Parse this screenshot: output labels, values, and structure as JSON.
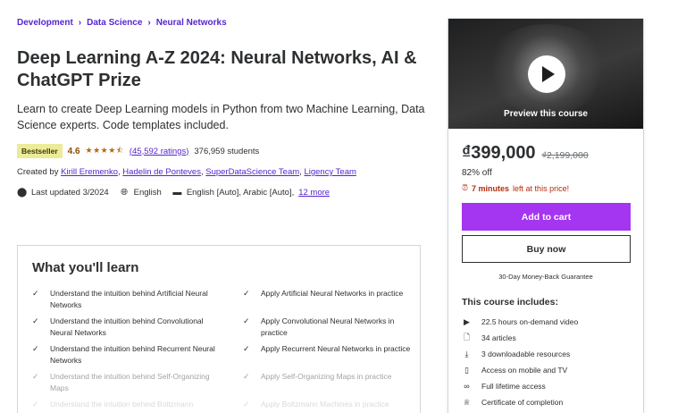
{
  "breadcrumb": [
    "Development",
    "Data Science",
    "Neural Networks"
  ],
  "course": {
    "title": "Deep Learning A-Z 2024: Neural Networks, AI & ChatGPT Prize",
    "subtitle": "Learn to create Deep Learning models in Python from two Machine Learning, Data Science experts. Code templates included.",
    "badge": "Bestseller",
    "rating": "4.6",
    "stars": "★★★★⯪",
    "ratings_count": "(45,592 ratings)",
    "students": "376,959 students",
    "created_by_label": "Created by",
    "authors": [
      "Kirill Eremenko",
      "Hadelin de Ponteves",
      "SuperDataScience Team",
      "Ligency Team"
    ],
    "last_updated": "Last updated 3/2024",
    "language": "English",
    "captions": "English [Auto], Arabic [Auto],",
    "captions_more": "12 more"
  },
  "learn": {
    "title": "What you'll learn",
    "left": [
      "Understand the intuition behind Artificial Neural Networks",
      "Understand the intuition behind Convolutional Neural Networks",
      "Understand the intuition behind Recurrent Neural Networks",
      "Understand the intuition behind Self-Organizing Maps",
      "Understand the intuition behind Boltzmann Machines"
    ],
    "right": [
      "Apply Artificial Neural Networks in practice",
      "Apply Convolutional Neural Networks in practice",
      "Apply Recurrent Neural Networks in practice",
      "Apply Self-Organizing Maps in practice",
      "Apply Boltzmann Machines in practice"
    ]
  },
  "sidebar": {
    "preview_label": "Preview this course",
    "price": "₫399,000",
    "original_price": "₫2,199,000",
    "discount": "82% off",
    "timer_bold": "7 minutes",
    "timer_rest": "left at this price!",
    "add_to_cart": "Add to cart",
    "buy_now": "Buy now",
    "guarantee": "30-Day Money-Back Guarantee",
    "includes_title": "This course includes:",
    "includes": [
      {
        "icon": "video-icon",
        "text": "22.5 hours on-demand video"
      },
      {
        "icon": "article-icon",
        "text": "34 articles"
      },
      {
        "icon": "download-icon",
        "text": "3 downloadable resources"
      },
      {
        "icon": "mobile-icon",
        "text": "Access on mobile and TV"
      },
      {
        "icon": "infinity-icon",
        "text": "Full lifetime access"
      },
      {
        "icon": "trophy-icon",
        "text": "Certificate of completion"
      }
    ]
  },
  "colors": {
    "link": "#5624d0",
    "accent": "#a435f0",
    "rating": "#b4690e",
    "badge_bg": "#eceb98",
    "timer": "#b32d0f"
  }
}
